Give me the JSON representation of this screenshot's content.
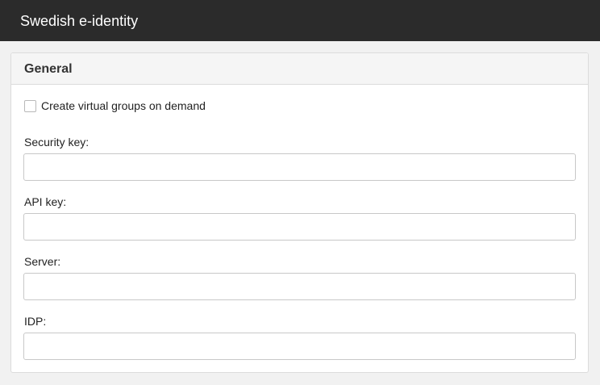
{
  "header": {
    "title": "Swedish e-identity"
  },
  "panel": {
    "title": "General",
    "checkbox": {
      "label": "Create virtual groups on demand",
      "checked": false
    },
    "fields": [
      {
        "label": "Security key:",
        "value": "",
        "placeholder": ""
      },
      {
        "label": "API key:",
        "value": "",
        "placeholder": ""
      },
      {
        "label": "Server:",
        "value": "",
        "placeholder": ""
      },
      {
        "label": "IDP:",
        "value": "",
        "placeholder": ""
      }
    ]
  }
}
